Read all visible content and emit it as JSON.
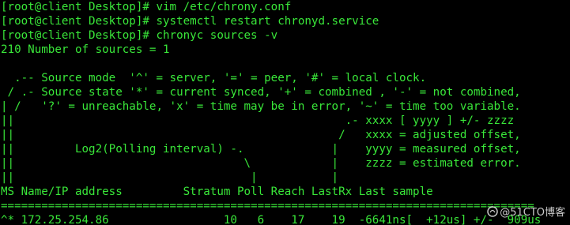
{
  "terminal": {
    "colors": {
      "background": "#000000",
      "foreground": "#39e639"
    },
    "lines": [
      "[root@client Desktop]# vim /etc/chrony.conf",
      "[root@client Desktop]# systemctl restart chronyd.service",
      "[root@client Desktop]# chronyc sources -v",
      "210 Number of sources = 1",
      "",
      "  .-- Source mode  '^' = server, '=' = peer, '#' = local clock.",
      " / .- Source state '*' = current synced, '+' = combined , '-' = not combined,",
      "| /   '?' = unreachable, 'x' = time may be in error, '~' = time too variable.",
      "||                                                 .- xxxx [ yyyy ] +/- zzzz",
      "||                                                /   xxxx = adjusted offset,",
      "||         Log2(Polling interval) -.             |    yyyy = measured offset,",
      "||                                  \\            |    zzzz = estimated error.",
      "||                                   |           |",
      "MS Name/IP address         Stratum Poll Reach LastRx Last sample",
      "===============================================================================",
      "^* 172.25.254.86                 10   6    17    19  -6641ns[  +12us] +/-  909us"
    ]
  },
  "watermark": {
    "text": "@51CTO博客",
    "icon": "51cto-logo-icon"
  }
}
